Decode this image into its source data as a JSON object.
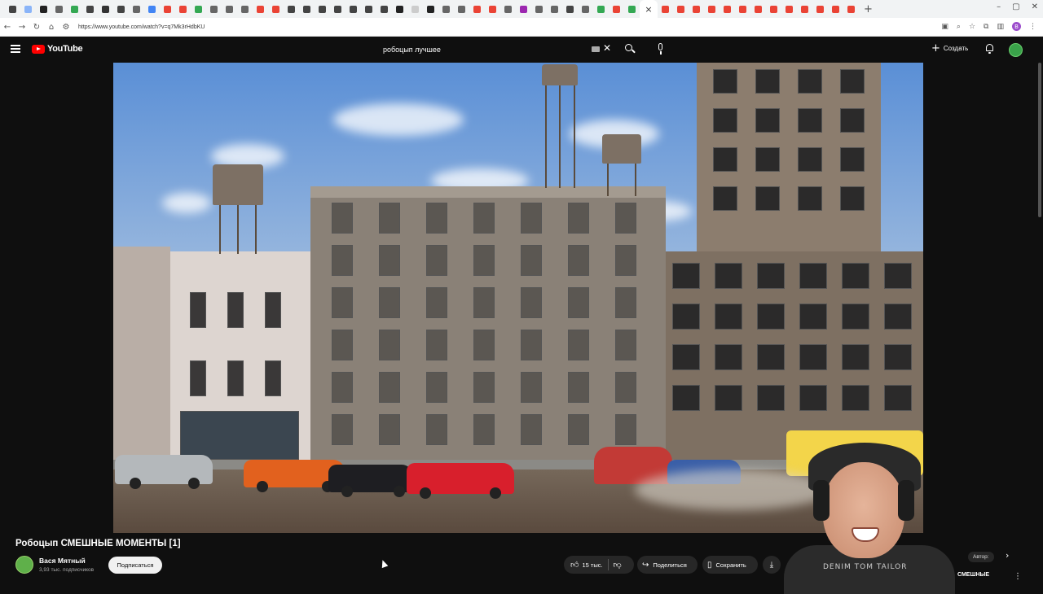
{
  "browser": {
    "url": "https://www.youtube.com/watch?v=q7Mk3rHdbKU",
    "tab_colors": [
      "#444444",
      "#8ab4f8",
      "#222222",
      "#666666",
      "#34a853",
      "#444444",
      "#333333",
      "#444444",
      "#666666",
      "#4285f4",
      "#ea4335",
      "#ea4335",
      "#34a853",
      "#666666",
      "#666666",
      "#666666",
      "#ea4335",
      "#ea4335",
      "#444444",
      "#444444",
      "#444444",
      "#444444",
      "#444444",
      "#444444",
      "#444444",
      "#222222",
      "#cccccc",
      "#222222",
      "#666666",
      "#666666",
      "#ea4335",
      "#ea4335",
      "#666666",
      "#9c27b0",
      "#666666",
      "#666666",
      "#444444",
      "#666666",
      "#34a853",
      "#ea4335",
      "#34a853"
    ],
    "active_tab_close": "×",
    "trailing_tab_colors": [
      "#ea4335",
      "#ea4335",
      "#ea4335",
      "#ea4335",
      "#ea4335",
      "#ea4335",
      "#ea4335",
      "#ea4335",
      "#ea4335",
      "#ea4335",
      "#ea4335",
      "#ea4335",
      "#ea4335"
    ],
    "new_tab": "+",
    "profile_initial": "B"
  },
  "youtube": {
    "logo_text": "YouTube",
    "search_query": "робоцып лучшее",
    "create_label": "Создать"
  },
  "video": {
    "title": "Робоцып СМЕШНЫЕ МОМЕНТЫ [1]",
    "channel_name": "Вася Мятный",
    "subscribers": "3,93 тыс. подписчиков",
    "subscribe_label": "Подписаться",
    "likes": "15 тыс.",
    "share_label": "Поделиться",
    "save_label": "Сохранить"
  },
  "side": {
    "author_chip": "Автор: ",
    "funny_chip": "СМЕШНЫЕ"
  },
  "webcam": {
    "shirt_text": "DENIM TOM TAILOR"
  },
  "colors": {
    "brand_red": "#ff0000",
    "background": "#0f0f0f",
    "pill": "#272727"
  }
}
